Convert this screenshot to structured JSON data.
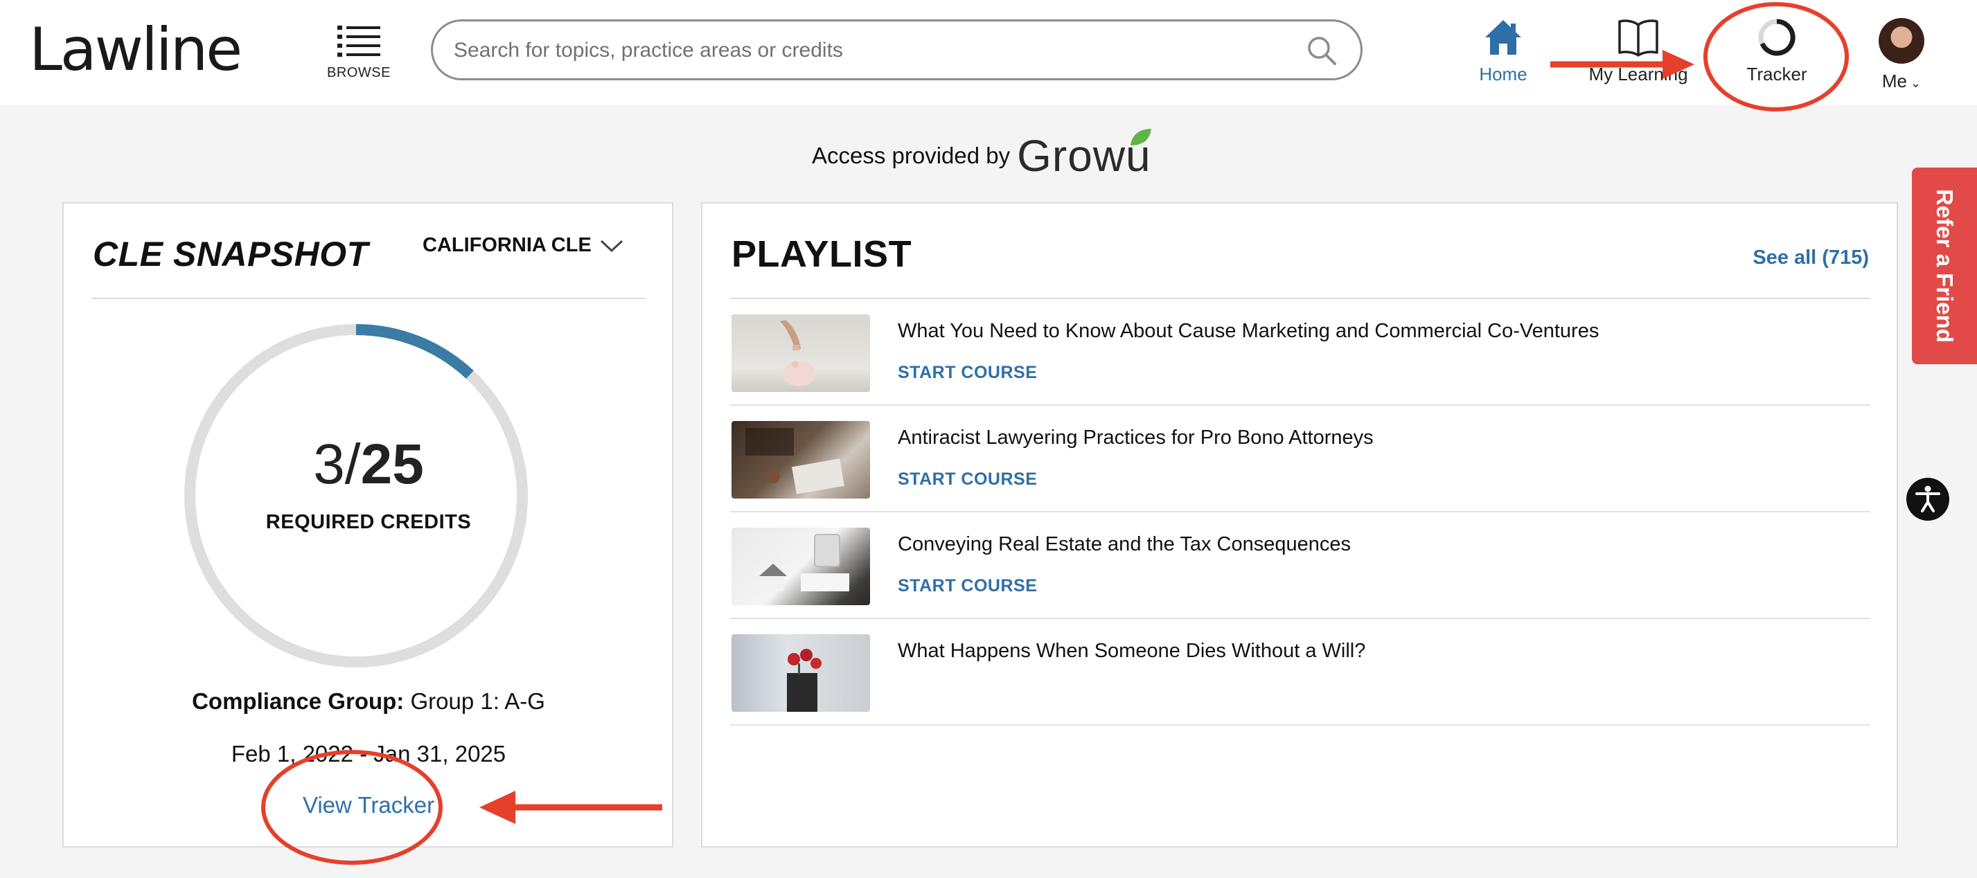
{
  "header": {
    "logo": "Lawline",
    "browse_label": "BROWSE",
    "search_placeholder": "Search for topics, practice areas or credits",
    "nav": {
      "home": "Home",
      "my_learning": "My Learning",
      "tracker": "Tracker",
      "me": "Me"
    }
  },
  "access": {
    "text": "Access provided by",
    "brand": "Growu"
  },
  "snapshot": {
    "title": "CLE SNAPSHOT",
    "state": "CALIFORNIA CLE",
    "credits_done": "3",
    "credits_sep": "/",
    "credits_required": "25",
    "credits_label": "REQUIRED CREDITS",
    "progress_fraction": 0.12,
    "compliance_label": "Compliance Group:",
    "compliance_value": "Group 1: A-G",
    "date_range": "Feb 1, 2022 - Jan 31, 2025",
    "view_tracker": "View Tracker"
  },
  "playlist": {
    "title": "PLAYLIST",
    "see_all": "See all (715)",
    "start_label": "START COURSE",
    "items": [
      {
        "title": "What You Need to Know About Cause Marketing and Commercial Co-Ventures",
        "action": "START COURSE"
      },
      {
        "title": "Antiracist Lawyering Practices for Pro Bono Attorneys",
        "action": "START COURSE"
      },
      {
        "title": "Conveying Real Estate and the Tax Consequences",
        "action": "START COURSE"
      },
      {
        "title": "What Happens When Someone Dies Without a Will?",
        "action": ""
      }
    ]
  },
  "side": {
    "refer": "Refer a Friend"
  },
  "colors": {
    "accent_blue": "#2f6fa8",
    "progress_blue": "#3a7ca5",
    "refer_red": "#e14a48",
    "annotation_red": "#e5402c"
  }
}
